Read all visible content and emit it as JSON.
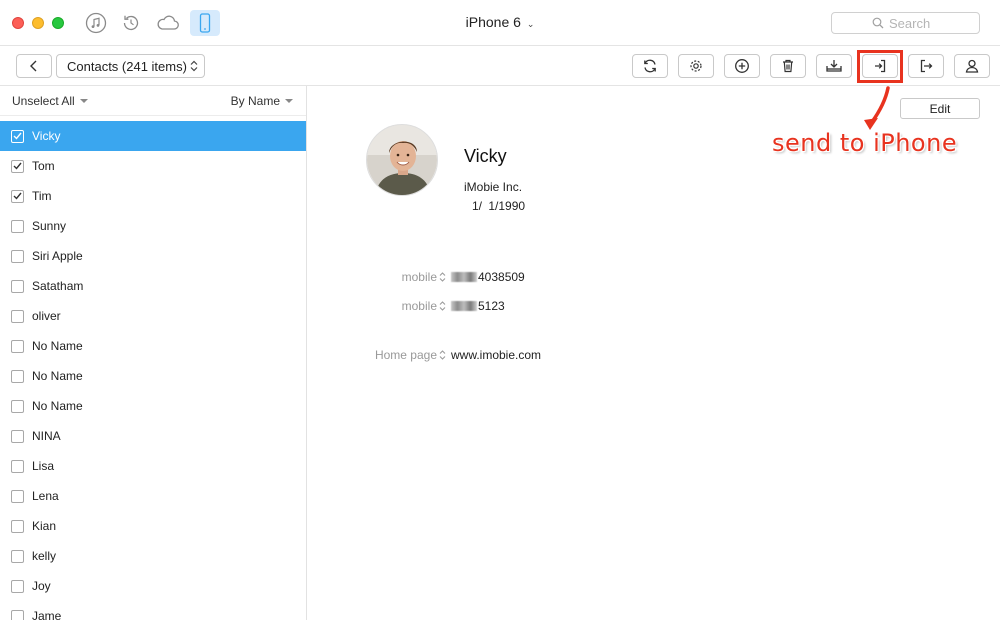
{
  "titlebar": {
    "device_name": "iPhone 6",
    "search_placeholder": "Search"
  },
  "toolbar": {
    "collection_label": "Contacts (241 items)"
  },
  "sidebar": {
    "select_label": "Unselect All",
    "sort_label": "By Name",
    "contacts": [
      {
        "name": "Vicky",
        "checked": true,
        "selected": true
      },
      {
        "name": "Tom",
        "checked": true,
        "selected": false
      },
      {
        "name": "Tim",
        "checked": true,
        "selected": false
      },
      {
        "name": "Sunny",
        "checked": false,
        "selected": false
      },
      {
        "name": "Siri Apple",
        "checked": false,
        "selected": false
      },
      {
        "name": "Satatham",
        "checked": false,
        "selected": false
      },
      {
        "name": "oliver",
        "checked": false,
        "selected": false
      },
      {
        "name": "No Name",
        "checked": false,
        "selected": false
      },
      {
        "name": "No Name",
        "checked": false,
        "selected": false
      },
      {
        "name": "No Name",
        "checked": false,
        "selected": false
      },
      {
        "name": "NINA",
        "checked": false,
        "selected": false
      },
      {
        "name": "Lisa",
        "checked": false,
        "selected": false
      },
      {
        "name": "Lena",
        "checked": false,
        "selected": false
      },
      {
        "name": "Kian",
        "checked": false,
        "selected": false
      },
      {
        "name": "kelly",
        "checked": false,
        "selected": false
      },
      {
        "name": "Joy",
        "checked": false,
        "selected": false
      },
      {
        "name": "Jame",
        "checked": false,
        "selected": false
      }
    ]
  },
  "detail": {
    "edit_label": "Edit",
    "annotation": "send to iPhone",
    "name": "Vicky",
    "company": "iMobie Inc.",
    "date": "1/ 1/1990",
    "fields": [
      {
        "label": "mobile",
        "value": "4038509"
      },
      {
        "label": "mobile",
        "value": "5123"
      },
      {
        "label": "Home page",
        "value": "www.imobie.com"
      }
    ]
  },
  "colors": {
    "accent": "#3aa6ef",
    "highlight": "#e8331f"
  }
}
